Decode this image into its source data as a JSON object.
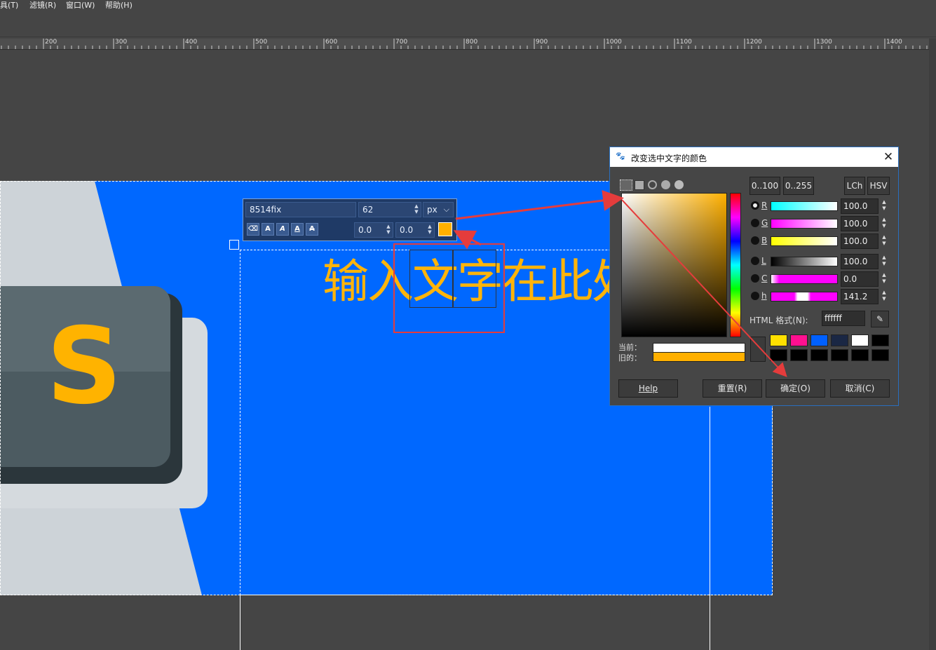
{
  "menubar": {
    "items": [
      "具(T)",
      "滤镜(R)",
      "窗口(W)",
      "帮助(H)"
    ]
  },
  "ruler": {
    "labels": [
      "200",
      "300",
      "400",
      "500",
      "600",
      "700",
      "800",
      "900",
      "1000",
      "1100",
      "1200",
      "1300",
      "1400"
    ]
  },
  "canvas": {
    "text": "输入文字在此处",
    "text_color": "#ffb40a",
    "background_color": "#0068ff",
    "logo_letter": "S"
  },
  "text_toolbar": {
    "font": "8514fix",
    "size": "62",
    "unit": "px",
    "baseline": "0.0",
    "kerning": "0.0",
    "style_buttons": [
      "A",
      "A",
      "A",
      "A"
    ],
    "color": "#ffb000"
  },
  "dialog": {
    "title": "改变选中文字的颜色",
    "range_buttons": [
      "0..100",
      "0..255"
    ],
    "model_buttons": [
      "LCh",
      "HSV"
    ],
    "sliders": [
      {
        "label": "R",
        "value": "100.0"
      },
      {
        "label": "G",
        "value": "100.0"
      },
      {
        "label": "B",
        "value": "100.0"
      },
      {
        "label": "L",
        "value": "100.0"
      },
      {
        "label": "C",
        "value": "0.0"
      },
      {
        "label": "h",
        "value": "141.2"
      }
    ],
    "html_label": "HTML 格式(N):",
    "html_value": "ffffff",
    "current_label": "当前：",
    "old_label": "旧的：",
    "current_color": "#ffffff",
    "old_color": "#ffb000",
    "history_swatches": [
      "#ffe000",
      "#ff1090",
      "#0060ff",
      "#1a2744",
      "#ffffff",
      "#000000",
      "#000000",
      "#000000",
      "#000000",
      "#000000",
      "#000000",
      "#000000"
    ],
    "buttons": {
      "help": "Help",
      "reset": "重置(R)",
      "ok": "确定(O)",
      "cancel": "取消(C)"
    }
  },
  "colors": {
    "annotation": "#e53c3c",
    "dialog_border": "#2a6fbf"
  }
}
